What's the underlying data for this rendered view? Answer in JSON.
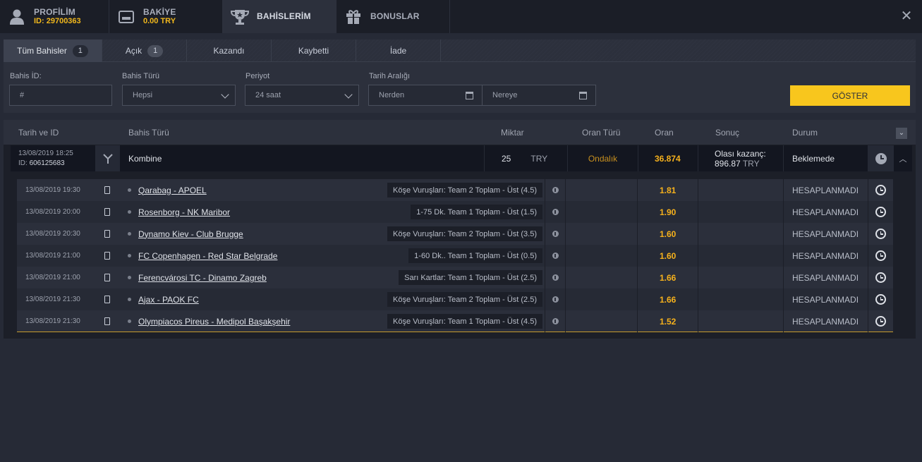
{
  "topnav": {
    "profile": {
      "title": "PROFİLİM",
      "sub": "ID: 29700363"
    },
    "balance": {
      "title": "BAKİYE",
      "sub": "0.00 TRY"
    },
    "bets": {
      "title": "BAHİSLERİM"
    },
    "bonuses": {
      "title": "BONUSLAR"
    },
    "close_icon": "close-icon"
  },
  "tabs": [
    {
      "label": "Tüm Bahisler",
      "count": "1"
    },
    {
      "label": "Açık",
      "count": "1"
    },
    {
      "label": "Kazandı"
    },
    {
      "label": "Kaybetti"
    },
    {
      "label": "İade"
    }
  ],
  "filters": {
    "bet_id": {
      "label": "Bahis İD:",
      "placeholder": "#"
    },
    "bet_type": {
      "label": "Bahis Türü",
      "value": "Hepsi"
    },
    "period": {
      "label": "Periyot",
      "value": "24 saat"
    },
    "date_range": {
      "label": "Tarih Aralığı",
      "from_placeholder": "Nerden",
      "to_placeholder": "Nereye"
    },
    "show_button": "GÖSTER"
  },
  "table": {
    "headers": {
      "date_id": "Tarih ve ID",
      "bet_type": "Bahis Türü",
      "amount": "Miktar",
      "odds_type": "Oran Türü",
      "odds": "Oran",
      "result": "Sonuç",
      "status": "Durum"
    },
    "bet": {
      "date": "13/08/2019 18:25",
      "id_label": "ID:",
      "id": "606125683",
      "type": "Kombine",
      "amount": "25",
      "currency": "TRY",
      "odds_type": "Ondalık",
      "odds": "36.874",
      "result_label": "Olası kazanç:",
      "result_value": "896.87",
      "result_currency": "TRY",
      "status": "Beklemede"
    },
    "selections": [
      {
        "date": "13/08/2019 19:30",
        "match": "Qarabag - APOEL",
        "market": "Köşe Vuruşları: Team 2 Toplam - Üst (4.5)",
        "odds": "1.81",
        "status": "HESAPLANMADI"
      },
      {
        "date": "13/08/2019 20:00",
        "match": "Rosenborg - NK Maribor",
        "market": "1-75 Dk. Team 1 Toplam - Üst (1.5)",
        "odds": "1.90",
        "status": "HESAPLANMADI"
      },
      {
        "date": "13/08/2019 20:30",
        "match": "Dynamo Kiev - Club Brugge",
        "market": "Köşe Vuruşları: Team 2 Toplam - Üst (3.5)",
        "odds": "1.60",
        "status": "HESAPLANMADI"
      },
      {
        "date": "13/08/2019 21:00",
        "match": "FC Copenhagen - Red Star Belgrade",
        "market": "1-60 Dk.. Team 1 Toplam - Üst (0.5)",
        "odds": "1.60",
        "status": "HESAPLANMADI"
      },
      {
        "date": "13/08/2019 21:00",
        "match": "Ferencvárosi TC - Dinamo Zagreb",
        "market": "Sarı Kartlar: Team 1 Toplam - Üst (2.5)",
        "odds": "1.66",
        "status": "HESAPLANMADI"
      },
      {
        "date": "13/08/2019 21:30",
        "match": "Ajax - PAOK FC",
        "market": "Köşe Vuruşları: Team 2 Toplam - Üst (2.5)",
        "odds": "1.66",
        "status": "HESAPLANMADI"
      },
      {
        "date": "13/08/2019 21:30",
        "match": "Olympiacos Pireus - Medipol Başakşehir",
        "market": "Köşe Vuruşları: Team 1 Toplam - Üst (4.5)",
        "odds": "1.52",
        "status": "HESAPLANMADI"
      }
    ]
  },
  "colors": {
    "accent": "#f8c61d",
    "odds": "#f6b11c",
    "odds_type": "#c8901e"
  }
}
